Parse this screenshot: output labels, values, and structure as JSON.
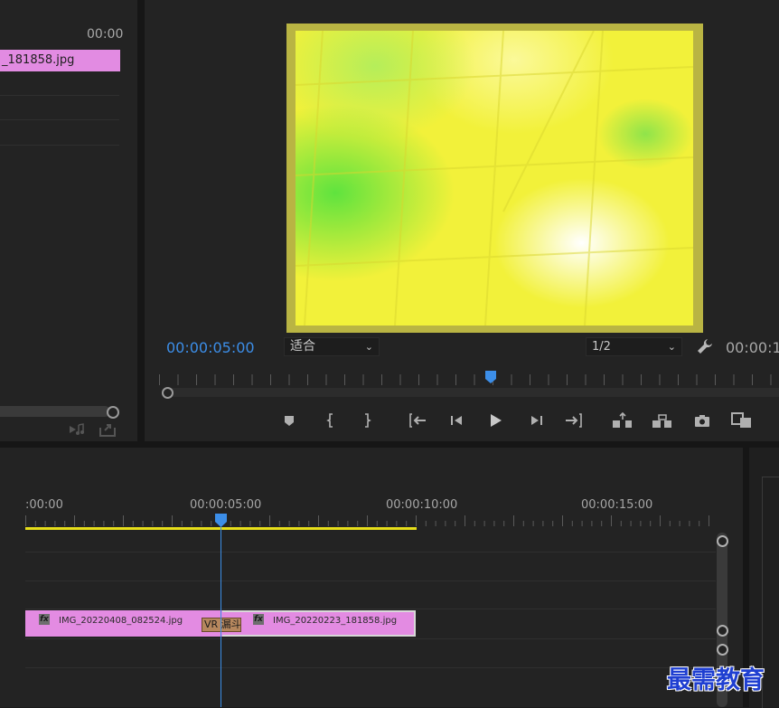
{
  "source_panel": {
    "timecode": "00:00",
    "clip_label": "_181858.jpg"
  },
  "program_monitor": {
    "current_timecode": "00:00:05:00",
    "fit_value": "适合",
    "resolution_value": "1/2",
    "end_timecode": "00:00:1",
    "controls": [
      {
        "name": "add-marker",
        "icon": "marker-icon"
      },
      {
        "name": "mark-in",
        "icon": "mark-in-icon"
      },
      {
        "name": "mark-out",
        "icon": "mark-out-icon"
      },
      {
        "name": "go-to-in",
        "icon": "go-to-in-icon"
      },
      {
        "name": "step-back",
        "icon": "step-back-icon"
      },
      {
        "name": "play",
        "icon": "play-icon"
      },
      {
        "name": "step-forward",
        "icon": "step-forward-icon"
      },
      {
        "name": "go-to-out",
        "icon": "go-to-out-icon"
      },
      {
        "name": "lift",
        "icon": "lift-icon"
      },
      {
        "name": "extract",
        "icon": "extract-icon"
      },
      {
        "name": "export-frame",
        "icon": "camera-icon"
      },
      {
        "name": "compare",
        "icon": "compare-icon"
      }
    ]
  },
  "timeline": {
    "ruler_labels": [
      ":00:00",
      "00:00:05:00",
      "00:00:10:00",
      "00:00:15:00"
    ],
    "clips": [
      {
        "name": "IMG_20220408_082524.jpg",
        "fx": "fx"
      },
      {
        "name": "IMG_20220223_181858.jpg",
        "fx": "fx"
      }
    ],
    "transition_label": "VR 漏斗"
  },
  "watermark": "最需教育",
  "colors": {
    "accent_blue": "#3c8ee8",
    "clip_pink": "#e38be2",
    "work_area_yellow": "#e6de1a",
    "transition_brown": "#b6875e"
  }
}
